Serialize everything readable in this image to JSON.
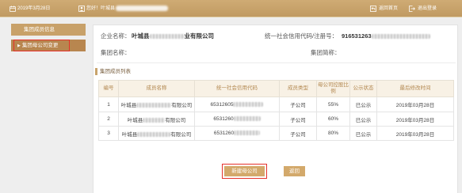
{
  "header": {
    "date": "2019年3月28日",
    "greeting": "您好！叶城县",
    "home_label": "返回首页",
    "logout_label": "退出登录",
    "icons": {
      "date": "calendar-icon",
      "user": "user-icon",
      "home": "home-return-icon",
      "logout": "logout-icon"
    }
  },
  "sidebar": {
    "items": [
      {
        "label": "集团成员信息",
        "active": false
      },
      {
        "label": "集团母公司变更",
        "active": true,
        "marker": "▶"
      }
    ]
  },
  "info": {
    "company_name_label": "企业名称：",
    "company_name_start": "叶城县",
    "company_name_end": "业有限公司",
    "credit_code_label": "统一社会信用代码/注册号：",
    "credit_code_start": "916531263",
    "group_name_label": "集团名称：",
    "group_short_label": "集团简称："
  },
  "section": {
    "title": "集团成员列表"
  },
  "table": {
    "columns": [
      "编号",
      "成员名称",
      "统一社会信用代码",
      "成员类型",
      "母公司控股比例",
      "公示状态",
      "最后修改时间"
    ],
    "rows": [
      {
        "no": "1",
        "name_start": "叶城县",
        "name_end": "有限公司",
        "code_start": "65312605",
        "type": "子公司",
        "ratio": "55%",
        "status": "已公示",
        "date": "2019年03月28日"
      },
      {
        "no": "2",
        "name_start": "叶城县",
        "name_end": "有限公司",
        "code_start": "6531260",
        "type": "子公司",
        "ratio": "60%",
        "status": "已公示",
        "date": "2019年03月28日"
      },
      {
        "no": "3",
        "name_start": "叶城县",
        "name_end": "有限公司",
        "code_start": "6531260",
        "type": "子公司",
        "ratio": "80%",
        "status": "已公示",
        "date": "2019年03月28日"
      }
    ]
  },
  "actions": {
    "new_parent_label": "新建母公司",
    "back_label": "返回"
  },
  "colors": {
    "brand": "#c8a36b",
    "active_item": "#b8864f",
    "header_text": "#b2874f",
    "highlight": "#e5322b",
    "button": "#d3a96b"
  }
}
